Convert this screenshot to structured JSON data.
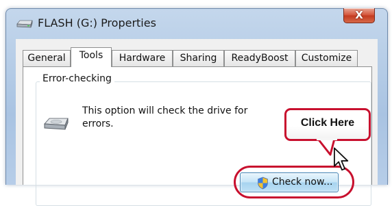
{
  "window": {
    "title": "FLASH (G:) Properties",
    "close_label": "X"
  },
  "tabs": [
    {
      "label": "General",
      "active": false
    },
    {
      "label": "Tools",
      "active": true
    },
    {
      "label": "Hardware",
      "active": false
    },
    {
      "label": "Sharing",
      "active": false
    },
    {
      "label": "ReadyBoost",
      "active": false
    },
    {
      "label": "Customize",
      "active": false
    }
  ],
  "error_checking": {
    "group_label": "Error-checking",
    "description": "This option will check the drive for errors.",
    "button_label": "Check now..."
  },
  "annotation": {
    "callout_text": "Click Here",
    "color": "#c8102e"
  },
  "icons": {
    "title": "drive-icon",
    "group": "hard-disk-icon",
    "button": "uac-shield-icon",
    "pointer": "mouse-cursor-icon"
  }
}
